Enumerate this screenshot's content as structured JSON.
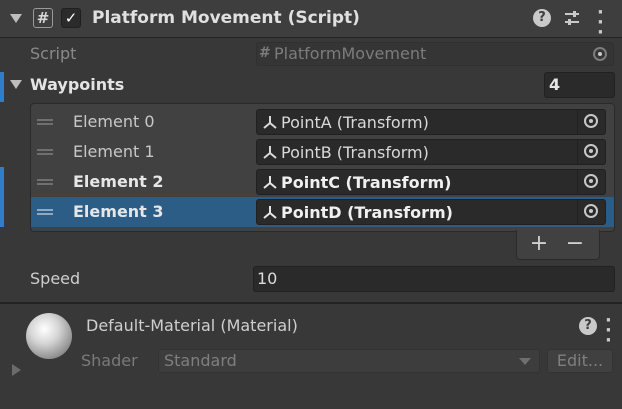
{
  "component": {
    "title": "Platform Movement (Script)",
    "enabled_mark": "✓",
    "script_label": "Script",
    "script_value": "PlatformMovement"
  },
  "waypoints": {
    "label": "Waypoints",
    "size": "4",
    "elements": [
      {
        "label": "Element 0",
        "value": "PointA (Transform)",
        "bold": false
      },
      {
        "label": "Element 1",
        "value": "PointB (Transform)",
        "bold": false
      },
      {
        "label": "Element 2",
        "value": "PointC (Transform)",
        "bold": true
      },
      {
        "label": "Element 3",
        "value": "PointD (Transform)",
        "bold": true
      }
    ],
    "add_label": "+",
    "remove_label": "−"
  },
  "speed": {
    "label": "Speed",
    "value": "10"
  },
  "material": {
    "title": "Default-Material (Material)",
    "shader_label": "Shader",
    "shader_value": "Standard",
    "edit_label": "Edit..."
  },
  "colors": {
    "selection": "#2c5d87",
    "accent_mark": "#2f7ec9"
  },
  "icons": [
    "foldout-arrow-icon",
    "script-hash-icon",
    "help-icon",
    "preset-sliders-icon",
    "more-dots-icon",
    "object-picker-icon",
    "transform-icon",
    "drag-handle-icon",
    "material-sphere-icon"
  ]
}
